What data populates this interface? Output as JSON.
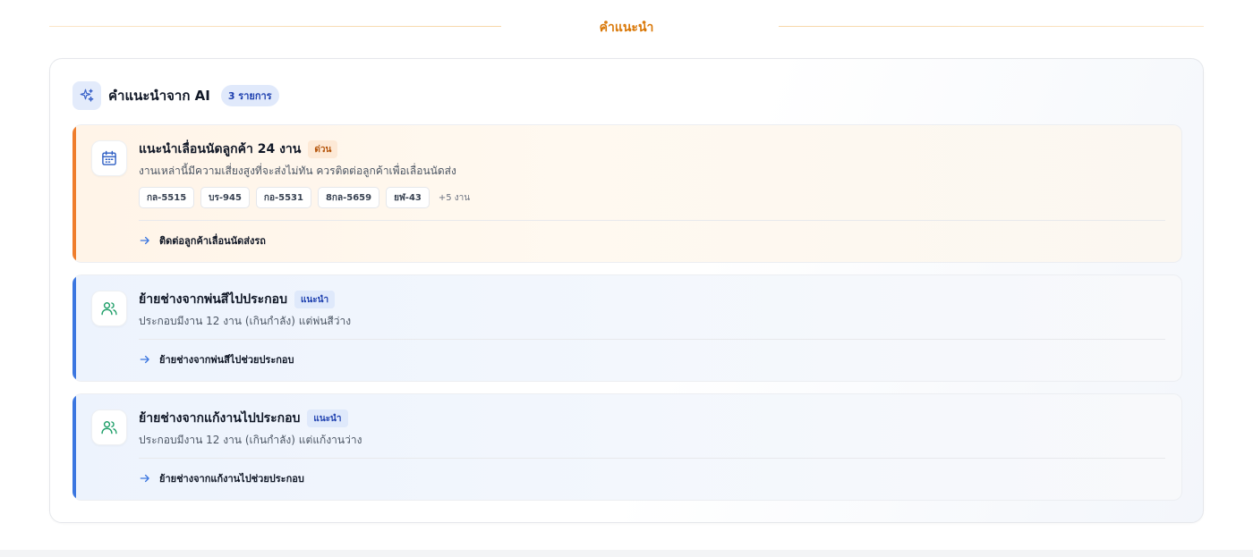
{
  "section": {
    "title": "คำแนะนำ"
  },
  "panel": {
    "title": "คำแนะนำจาก AI",
    "count_badge": "3 รายการ",
    "icon": "sparkles-icon"
  },
  "recommendations": [
    {
      "kind": "urgent",
      "icon": "calendar-icon",
      "title": "แนะนำเลื่อนนัดลูกค้า 24 งาน",
      "tag": "ด่วน",
      "description": "งานเหล่านี้มีความเสี่ยงสูงที่จะส่งไม่ทัน ควรติดต่อลูกค้าเพื่อเลื่อนนัดส่ง",
      "plates": [
        "กล-5515",
        "บร-945",
        "กอ-5531",
        "8กล-5659",
        "ยฬ-43"
      ],
      "more": "+5 งาน",
      "action": "ติดต่อลูกค้าเลื่อนนัดส่งรถ"
    },
    {
      "kind": "suggest",
      "icon": "users-icon",
      "title": "ย้ายช่างจากพ่นสีไปประกอบ",
      "tag": "แนะนำ",
      "description": "ประกอบมีงาน 12 งาน (เกินกำลัง) แต่พ่นสีว่าง",
      "action": "ย้ายช่างจากพ่นสีไปช่วยประกอบ"
    },
    {
      "kind": "suggest",
      "icon": "users-icon",
      "title": "ย้ายช่างจากแก้งานไปประกอบ",
      "tag": "แนะนำ",
      "description": "ประกอบมีงาน 12 งาน (เกินกำลัง) แต่แก้งานว่าง",
      "action": "ย้ายช่างจากแก้งานไปช่วยประกอบ"
    }
  ],
  "colors": {
    "urgent_accent": "#ef7d2c",
    "suggest_accent": "#3b76e0",
    "section_title": "#d97706"
  }
}
